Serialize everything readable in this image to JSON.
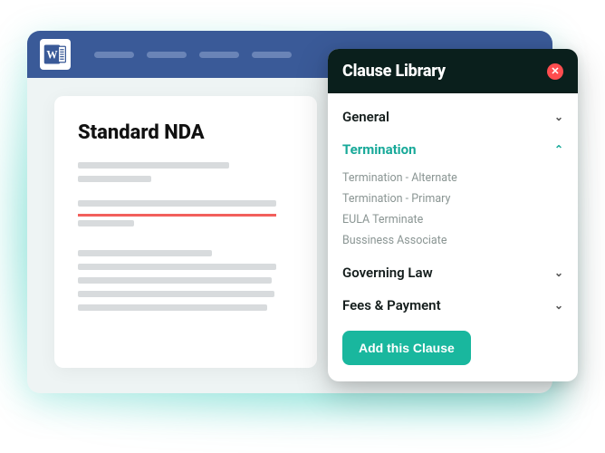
{
  "document": {
    "title": "Standard NDA"
  },
  "panel": {
    "title": "Clause Library",
    "categories": [
      {
        "label": "General",
        "open": false
      },
      {
        "label": "Termination",
        "open": true,
        "items": [
          "Termination - Alternate",
          "Termination - Primary",
          "EULA Terminate",
          "Bussiness Associate"
        ]
      },
      {
        "label": "Governing Law",
        "open": false
      },
      {
        "label": "Fees & Payment",
        "open": false
      }
    ],
    "add_button": "Add this Clause"
  }
}
